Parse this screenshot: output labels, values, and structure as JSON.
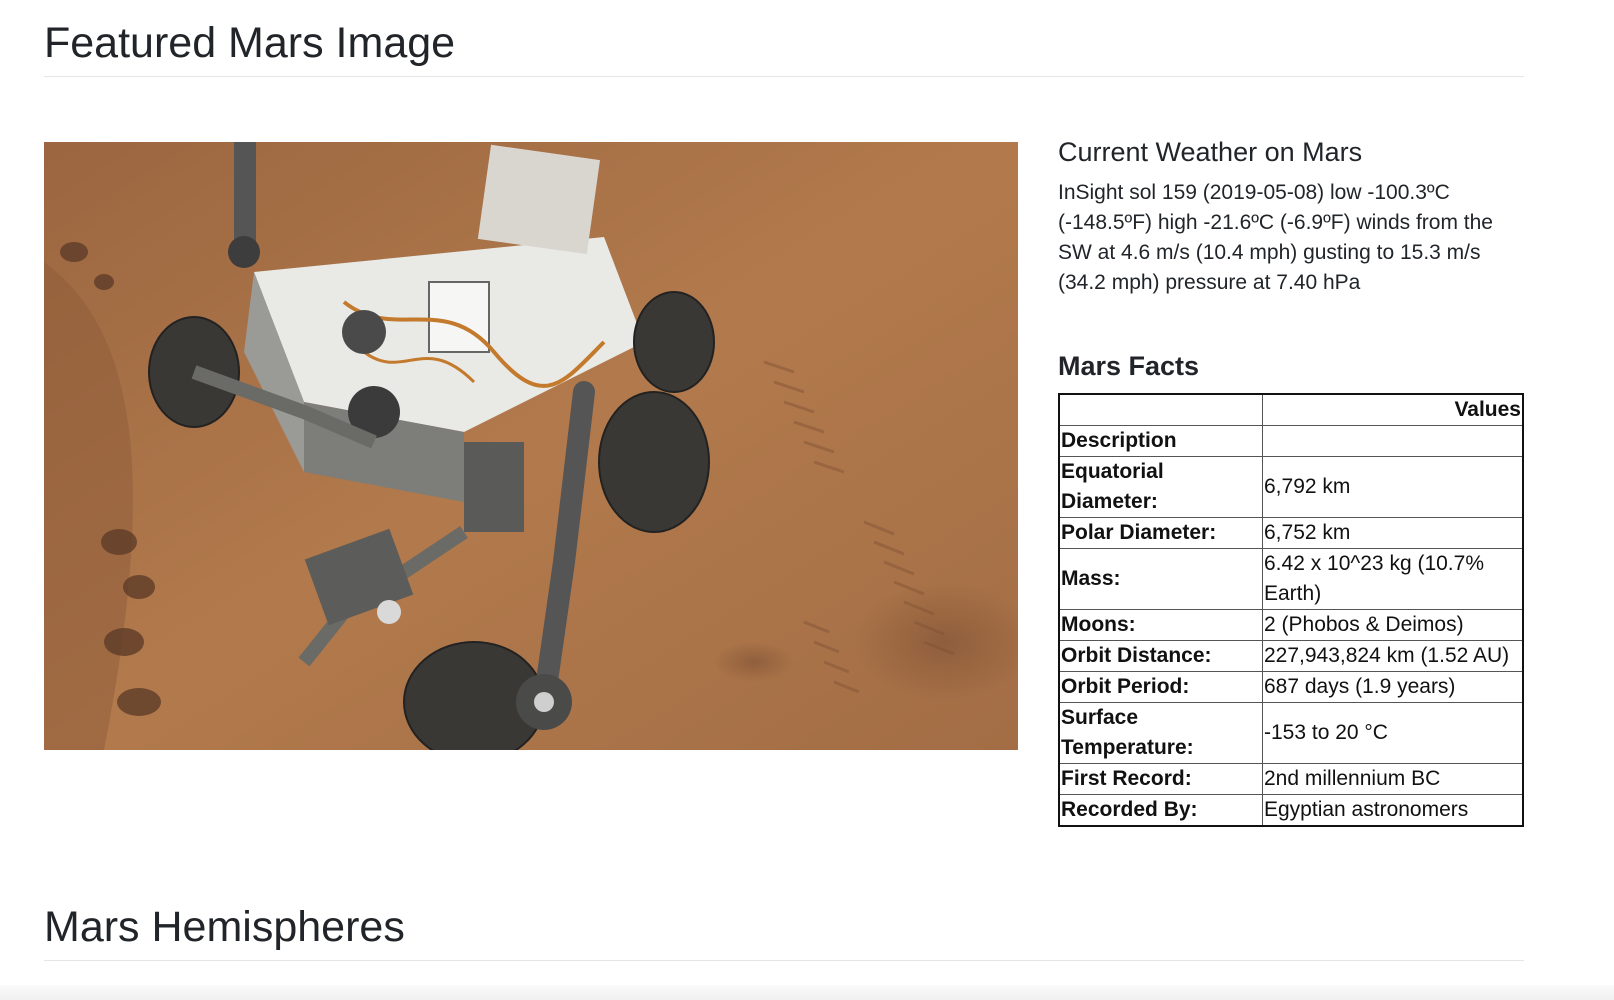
{
  "featured": {
    "title": "Featured Mars Image"
  },
  "weather": {
    "title": "Current Weather on Mars",
    "text": "InSight sol 159 (2019-05-08) low -100.3ºC (-148.5ºF) high -21.6ºC (-6.9ºF) winds from the SW at 4.6 m/s (10.4 mph) gusting to 15.3 m/s (34.2 mph) pressure at 7.40 hPa"
  },
  "facts": {
    "title": "Mars Facts",
    "header_value": "Values",
    "description_label": "Description",
    "rows": [
      {
        "key": "Equatorial Diameter:",
        "value": "6,792 km"
      },
      {
        "key": "Polar Diameter:",
        "value": "6,752 km"
      },
      {
        "key": "Mass:",
        "value": "6.42 x 10^23 kg (10.7% Earth)"
      },
      {
        "key": "Moons:",
        "value": "2 (Phobos & Deimos)"
      },
      {
        "key": "Orbit Distance:",
        "value": "227,943,824 km (1.52 AU)"
      },
      {
        "key": "Orbit Period:",
        "value": "687 days (1.9 years)"
      },
      {
        "key": "Surface Temperature:",
        "value": "-153 to 20 °C"
      },
      {
        "key": "First Record:",
        "value": "2nd millennium BC"
      },
      {
        "key": "Recorded By:",
        "value": "Egyptian astronomers"
      }
    ]
  },
  "hemispheres": {
    "title": "Mars Hemispheres"
  }
}
